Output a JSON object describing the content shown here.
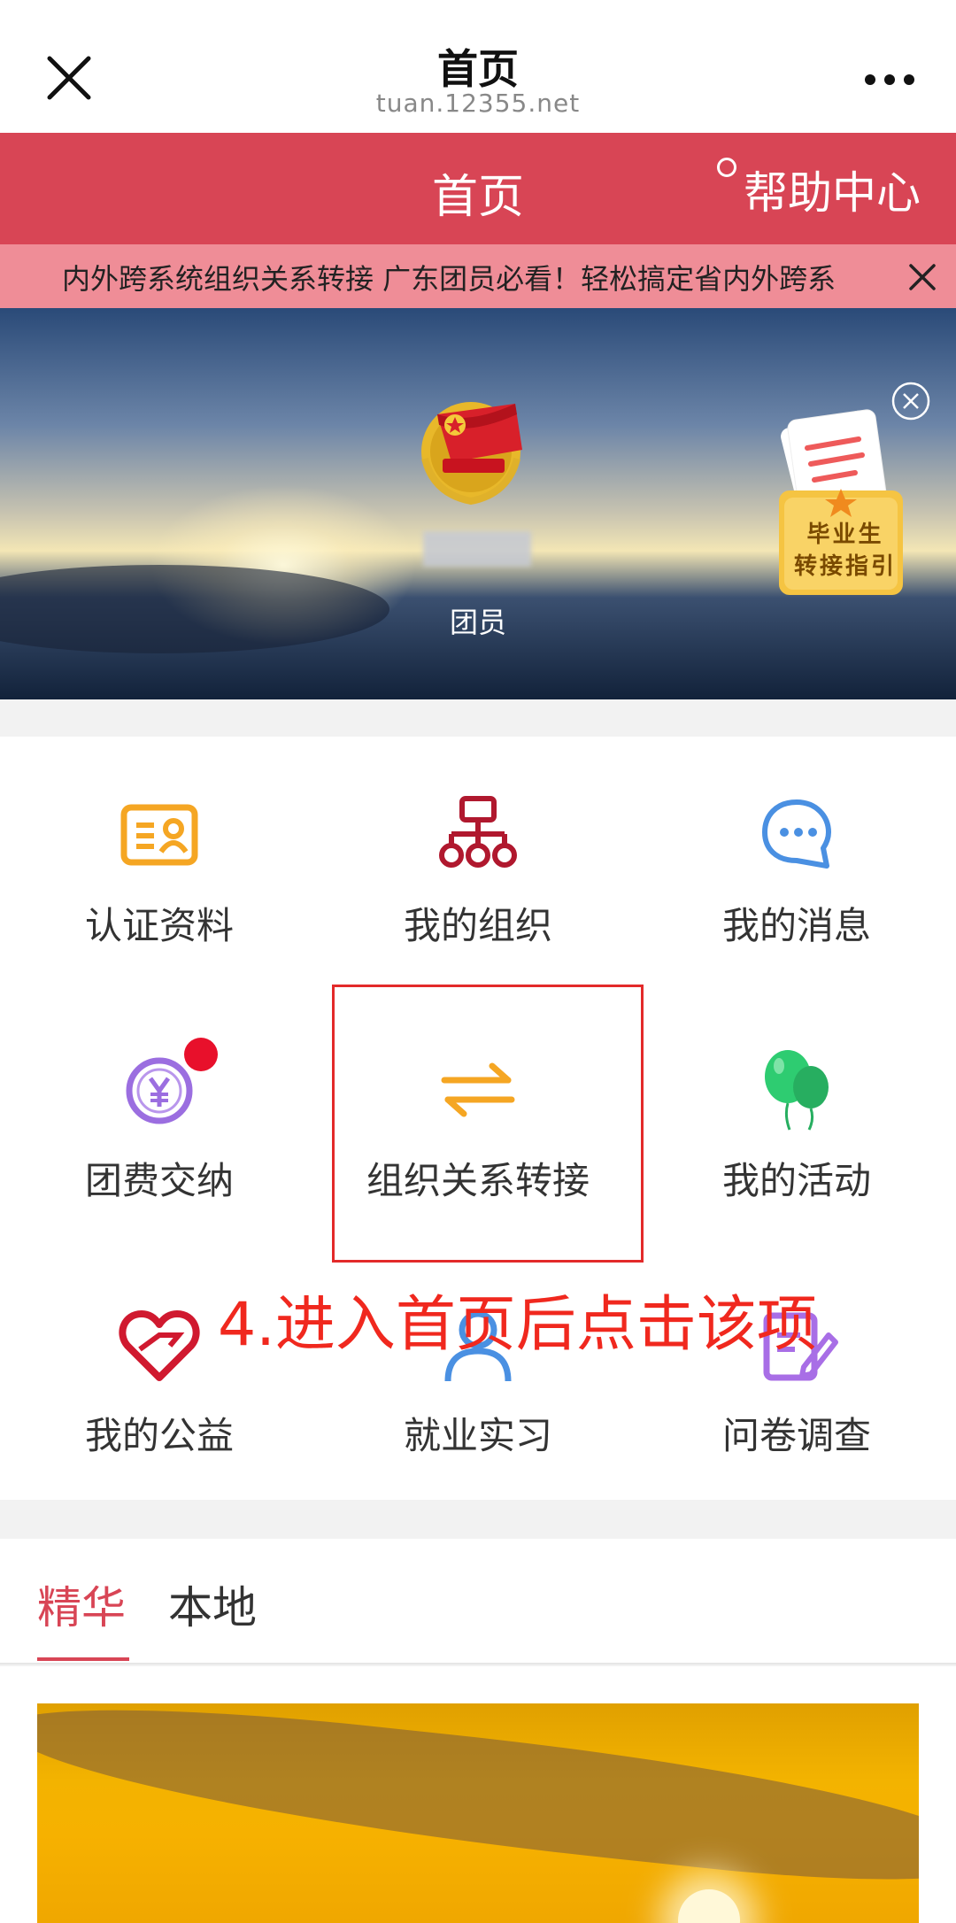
{
  "nav": {
    "title": "首页",
    "url": "tuan.12355.net"
  },
  "redbar": {
    "title": "首页",
    "help": "帮助中心"
  },
  "marquee": {
    "text": "内外跨系统组织关系转接      广东团员必看！轻松搞定省内外跨系"
  },
  "hero": {
    "role": "团员",
    "grad_card_line1": "毕业生",
    "grad_card_line2": "转接指引"
  },
  "menu": {
    "items": [
      {
        "label": "认证资料",
        "icon": "profile-card-icon"
      },
      {
        "label": "我的组织",
        "icon": "org-chart-icon"
      },
      {
        "label": "我的消息",
        "icon": "chat-bubble-icon"
      },
      {
        "label": "团费交纳",
        "icon": "yuan-coin-icon"
      },
      {
        "label": "组织关系转接",
        "icon": "transfer-arrows-icon"
      },
      {
        "label": "我的活动",
        "icon": "balloons-icon"
      },
      {
        "label": "我的公益",
        "icon": "heart-hand-icon"
      },
      {
        "label": "就业实习",
        "icon": "person-icon"
      },
      {
        "label": "问卷调查",
        "icon": "survey-edit-icon"
      }
    ]
  },
  "annotation": "4.进入首页后点击该项",
  "tabs": [
    {
      "label": "精华",
      "active": true
    },
    {
      "label": "本地",
      "active": false
    }
  ],
  "colors": {
    "accent": "#d84555",
    "marquee": "#ef8d97",
    "annotation": "#f0281e"
  }
}
